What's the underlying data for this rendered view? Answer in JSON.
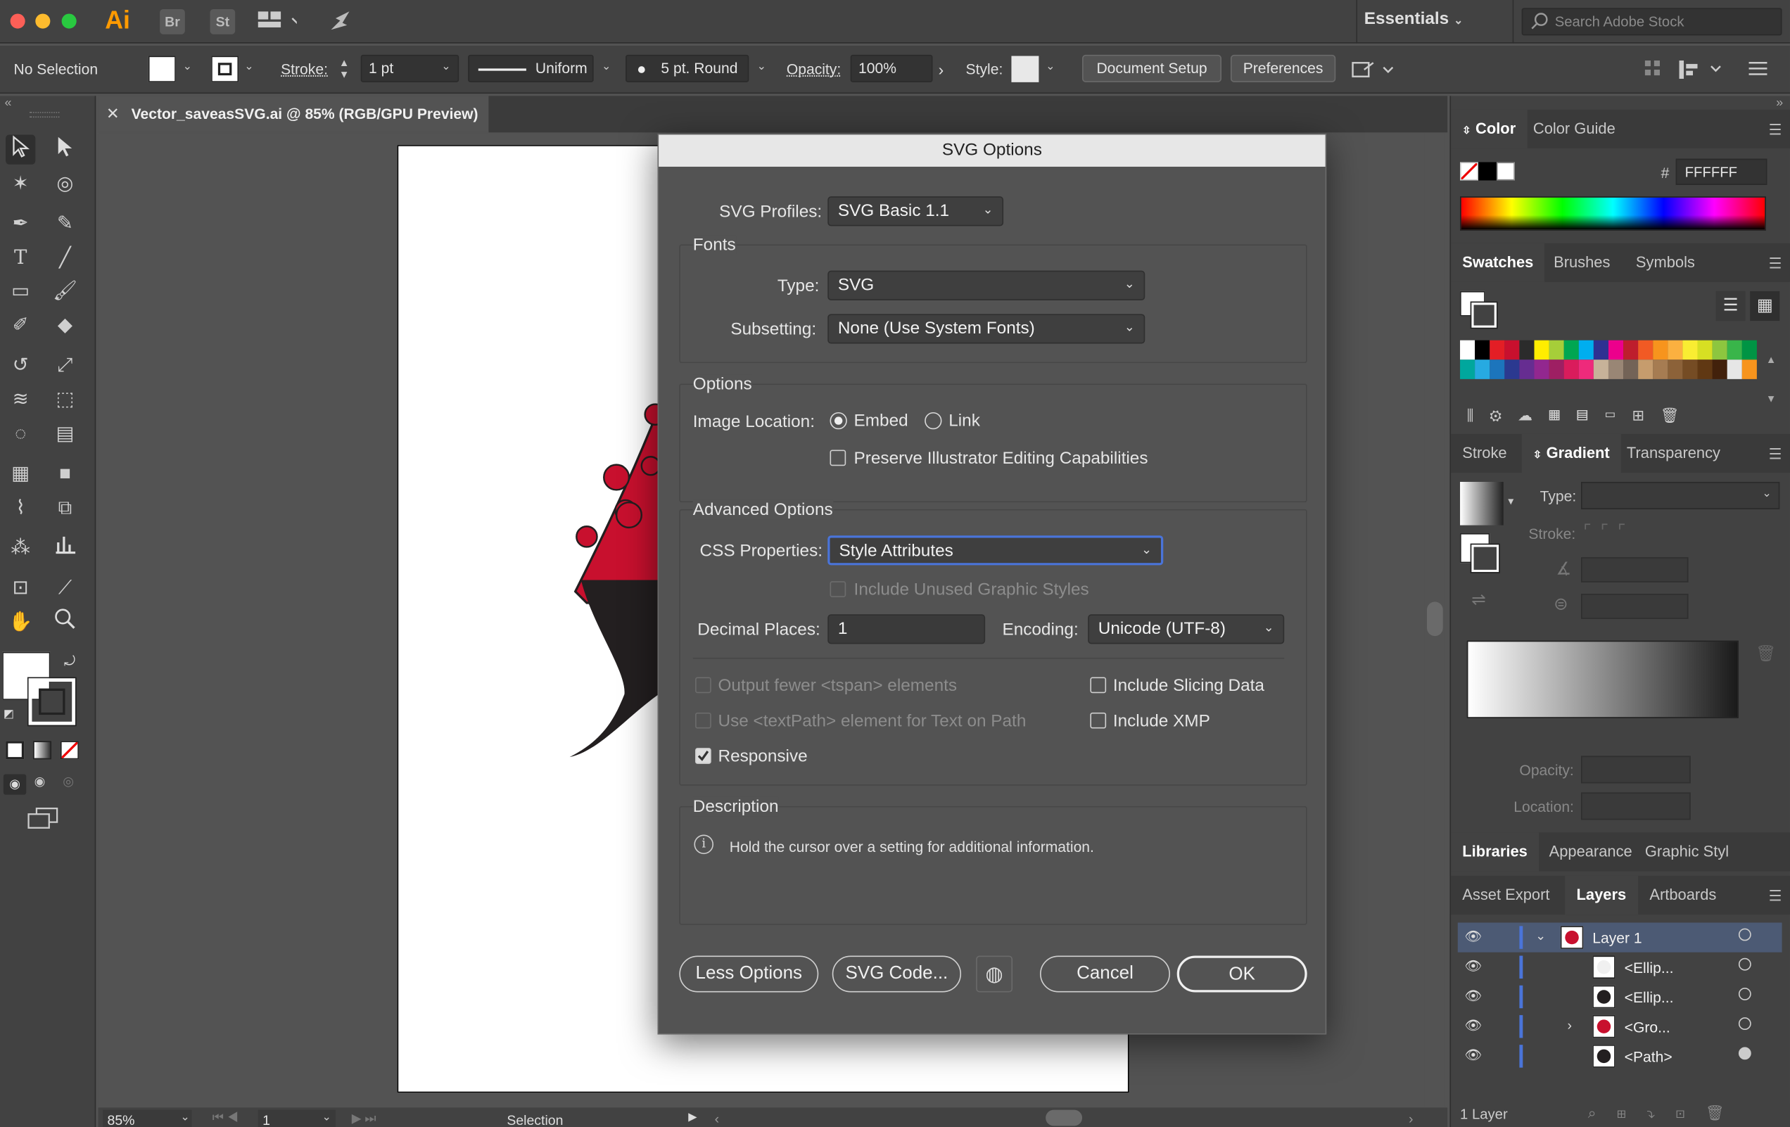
{
  "menubar": {
    "app_icon": "Ai",
    "apps": [
      "Br",
      "St"
    ],
    "workspace": "Essentials",
    "search_placeholder": "Search Adobe Stock"
  },
  "control_bar": {
    "selection": "No Selection",
    "stroke_label": "Stroke:",
    "stroke_value": "1 pt",
    "profile": "Uniform",
    "brush": "5 pt. Round",
    "opacity_label": "Opacity:",
    "opacity_value": "100%",
    "style_label": "Style:",
    "doc_setup": "Document Setup",
    "preferences": "Preferences"
  },
  "document": {
    "tab_title": "Vector_saveasSVG.ai @ 85% (RGB/GPU Preview)",
    "zoom": "85%",
    "artboard_num": "1",
    "status_text": "Selection"
  },
  "dialog": {
    "title": "SVG Options",
    "svg_profiles_label": "SVG Profiles:",
    "svg_profiles_value": "SVG Basic 1.1",
    "fonts_header": "Fonts",
    "type_label": "Type:",
    "type_value": "SVG",
    "subsetting_label": "Subsetting:",
    "subsetting_value": "None (Use System Fonts)",
    "options_header": "Options",
    "image_location_label": "Image Location:",
    "embed_label": "Embed",
    "link_label": "Link",
    "preserve_label": "Preserve Illustrator Editing Capabilities",
    "advanced_header": "Advanced Options",
    "css_label": "CSS Properties:",
    "css_value": "Style Attributes",
    "unused_styles_label": "Include Unused Graphic Styles",
    "decimal_label": "Decimal Places:",
    "decimal_value": "1",
    "encoding_label": "Encoding:",
    "encoding_value": "Unicode (UTF-8)",
    "tspan_label": "Output fewer <tspan> elements",
    "textpath_label": "Use <textPath> element for Text on Path",
    "responsive_label": "Responsive",
    "slicing_label": "Include Slicing Data",
    "xmp_label": "Include XMP",
    "description_header": "Description",
    "description_text": "Hold the cursor over a setting for additional information.",
    "less_options": "Less Options",
    "svg_code": "SVG Code...",
    "cancel": "Cancel",
    "ok": "OK"
  },
  "panels": {
    "color_tabs": [
      "Color",
      "Color Guide"
    ],
    "hex_label": "#",
    "hex_value": "FFFFFF",
    "swatch_tabs": [
      "Swatches",
      "Brushes",
      "Symbols"
    ],
    "gradient_tabs": [
      "Stroke",
      "Gradient",
      "Transparency"
    ],
    "gradient_type_label": "Type:",
    "gradient_stroke_label": "Stroke:",
    "opacity_label": "Opacity:",
    "location_label": "Location:",
    "lib_tabs": [
      "Libraries",
      "Appearance",
      "Graphic Styl"
    ],
    "layer_tabs": [
      "Asset Export",
      "Layers",
      "Artboards"
    ],
    "layers": [
      "Layer 1",
      "<Ellip...",
      "<Ellip...",
      "<Gro...",
      "<Path>"
    ],
    "layer_count": "1 Layer"
  },
  "colors": {
    "accent": "#4a74d9",
    "artboard_red": "#c8102e",
    "dark": "#231f20"
  },
  "swatch_colors": [
    "#ffffff",
    "#000000",
    "#e31e25",
    "#c8102e",
    "#2b2b2b",
    "#ffed00",
    "#a6ce39",
    "#00a651",
    "#00aeef",
    "#2e3192",
    "#ec008c",
    "#be1e2d",
    "#f15a24",
    "#f7941d",
    "#fbb040",
    "#f9ed32",
    "#d7df23",
    "#8dc63f",
    "#39b54a",
    "#009444",
    "#00a79d",
    "#27aae1",
    "#1c75bc",
    "#2b3990",
    "#662d91",
    "#92278f",
    "#9e1f63",
    "#da1c5c",
    "#ee2a7b",
    "#c7b299",
    "#998675",
    "#736357",
    "#c69c6d",
    "#a67c52",
    "#8c6239",
    "#754c24",
    "#603813",
    "#42210b",
    "#e6e6e6",
    "#f7941d"
  ]
}
